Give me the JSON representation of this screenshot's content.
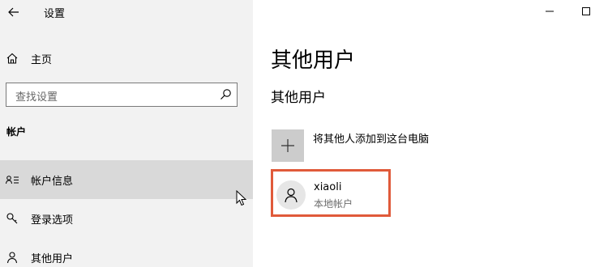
{
  "app": {
    "title": "设置"
  },
  "sidebar": {
    "home_label": "主页",
    "search_placeholder": "查找设置",
    "section_header": "帐户",
    "items": [
      {
        "label": "帐户信息",
        "icon": "account-info-icon",
        "active": true
      },
      {
        "label": "登录选项",
        "icon": "key-icon",
        "active": false
      },
      {
        "label": "其他用户",
        "icon": "person-icon",
        "active": false
      }
    ]
  },
  "main": {
    "page_title": "其他用户",
    "section_title": "其他用户",
    "add_label": "将其他人添加到这台电脑",
    "user": {
      "name": "xiaoli",
      "type": "本地帐户"
    }
  },
  "colors": {
    "sidebar_bg": "#f2f2f2",
    "active_item_bg": "#d9d9d9",
    "highlight_border": "#e05a3a",
    "add_tile_bg": "#cccccc"
  }
}
